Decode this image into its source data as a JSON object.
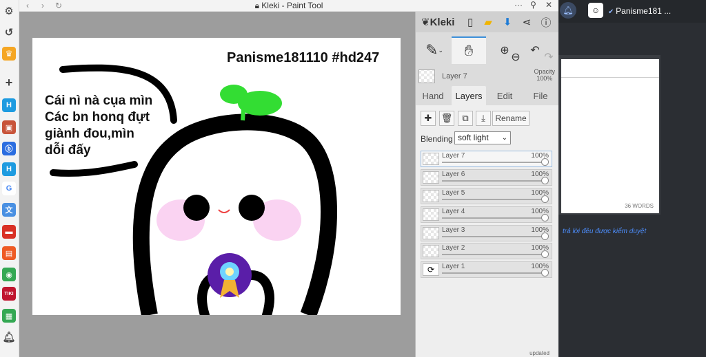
{
  "window": {
    "title": "Kleki - Paint Tool",
    "lock_icon": "lock-icon"
  },
  "canvas": {
    "caption": "Panisme181110 #hd247",
    "speech_lines": [
      "Cái nì nà cụa mìn",
      "Các bn honq đựt",
      "giành đou,mìn",
      "dỗi đấy"
    ]
  },
  "panel": {
    "brand": "Kleki",
    "layer_preview": {
      "name": "Layer 7",
      "opacity_label": "Opacity",
      "opacity_value": "100%"
    },
    "tabs": [
      "Hand",
      "Layers",
      "Edit",
      "File"
    ],
    "active_tab": "Layers",
    "rename_label": "Rename",
    "blending_label": "Blending",
    "blending_value": "soft light",
    "layers": [
      {
        "name": "Layer 7",
        "opacity": "100%",
        "selected": true
      },
      {
        "name": "Layer 6",
        "opacity": "100%"
      },
      {
        "name": "Layer 5",
        "opacity": "100%"
      },
      {
        "name": "Layer 4",
        "opacity": "100%"
      },
      {
        "name": "Layer 3",
        "opacity": "100%"
      },
      {
        "name": "Layer 2",
        "opacity": "100%"
      },
      {
        "name": "Layer 1",
        "opacity": "100%"
      }
    ],
    "footer": "updated"
  },
  "right": {
    "username": "Panisme181 ...",
    "word_count": "36 WORDS",
    "notice": "trả lời đều được kiểm duyệt"
  },
  "colors": {
    "accent": "#3b8fd9",
    "panel_bg": "#dcdcdc",
    "canvas_bg": "#9d9d9d",
    "dark_bg": "#2b2e33",
    "sprout": "#33dd33"
  }
}
